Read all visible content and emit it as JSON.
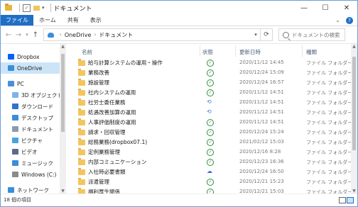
{
  "window": {
    "title": "ドキュメント",
    "minimize": "—",
    "maximize": "☐",
    "close": "✕"
  },
  "ribbon": {
    "tabs": [
      "ファイル",
      "ホーム",
      "共有",
      "表示"
    ]
  },
  "address": {
    "segments": [
      "OneDrive",
      "ドキュメント"
    ],
    "search_placeholder": "ドキュメントの検索"
  },
  "nav_pane": {
    "items": [
      {
        "label": "Dropbox",
        "icon": "dropbox-icon",
        "color": "#0061fe",
        "indent": 0,
        "selected": false
      },
      {
        "label": "OneDrive",
        "icon": "onedrive-icon",
        "color": "#3b8ed8",
        "indent": 0,
        "selected": true
      },
      {
        "label": "PC",
        "icon": "pc-icon",
        "color": "#4a90d9",
        "indent": 0,
        "selected": false
      },
      {
        "label": "3D オブジェクト",
        "icon": "3d-objects-icon",
        "color": "#7fb3e6",
        "indent": 1,
        "selected": false
      },
      {
        "label": "ダウンロード",
        "icon": "download-icon",
        "color": "#2f74c9",
        "indent": 1,
        "selected": false
      },
      {
        "label": "デスクトップ",
        "icon": "desktop-icon",
        "color": "#3b8ed8",
        "indent": 1,
        "selected": false
      },
      {
        "label": "ドキュメント",
        "icon": "documents-icon",
        "color": "#8a9bb0",
        "indent": 1,
        "selected": false
      },
      {
        "label": "ピクチャ",
        "icon": "pictures-icon",
        "color": "#4aa3df",
        "indent": 1,
        "selected": false
      },
      {
        "label": "ビデオ",
        "icon": "videos-icon",
        "color": "#5c6b8a",
        "indent": 1,
        "selected": false
      },
      {
        "label": "ミュージック",
        "icon": "music-icon",
        "color": "#3b8ed8",
        "indent": 1,
        "selected": false
      },
      {
        "label": "Windows (C:)",
        "icon": "drive-icon",
        "color": "#8a8a8a",
        "indent": 1,
        "selected": false
      },
      {
        "label": "ネットワーク",
        "icon": "network-icon",
        "color": "#3b8ed8",
        "indent": 0,
        "selected": false
      }
    ]
  },
  "columns": {
    "name": "名前",
    "status": "状態",
    "date": "更新日時",
    "type": "種類"
  },
  "files": [
    {
      "name": "給与計算システムの運用・操作",
      "status": "ok",
      "date": "2020/11/12 14:45",
      "type": "ファイル フォルダー"
    },
    {
      "name": "業務改善",
      "status": "ok",
      "date": "2020/12/24 15:09",
      "type": "ファイル フォルダー"
    },
    {
      "name": "施設管理",
      "status": "ok",
      "date": "2020/12/24 16:57",
      "type": "ファイル フォルダー"
    },
    {
      "name": "社内システムの運用",
      "status": "ok",
      "date": "2020/11/12 14:51",
      "type": "ファイル フォルダー"
    },
    {
      "name": "社労士委任業務",
      "status": "sync",
      "date": "2020/11/12 14:51",
      "type": "ファイル フォルダー"
    },
    {
      "name": "処遇改善加算の運用",
      "status": "sync",
      "date": "2020/11/12 14:51",
      "type": "ファイル フォルダー"
    },
    {
      "name": "人事評価制度の運用",
      "status": "ok",
      "date": "2020/11/12 14:51",
      "type": "ファイル フォルダー"
    },
    {
      "name": "請求・回収管理",
      "status": "ok",
      "date": "2020/12/24 15:24",
      "type": "ファイル フォルダー"
    },
    {
      "name": "総務業務(dropbox07.1)",
      "status": "ok",
      "date": "2021/02/12 15:03",
      "type": "ファイル フォルダー"
    },
    {
      "name": "定例業務管理",
      "status": "ok",
      "date": "2020/12/16 8:28",
      "type": "ファイル フォルダー"
    },
    {
      "name": "内部コミュニケーション",
      "status": "ok",
      "date": "2020/12/23 16:36",
      "type": "ファイル フォルダー"
    },
    {
      "name": "入社時必要書類",
      "status": "cloud",
      "date": "2020/12/24 16:50",
      "type": "ファイル フォルダー"
    },
    {
      "name": "派遣管理",
      "status": "ok",
      "date": "2020/12/21 15:23",
      "type": "ファイル フォルダー"
    },
    {
      "name": "福利厚生関係",
      "status": "ok",
      "date": "2020/12/21 15:03",
      "type": "ファイル フォルダー"
    }
  ],
  "status_bar": {
    "item_count": "18 個の項目"
  }
}
